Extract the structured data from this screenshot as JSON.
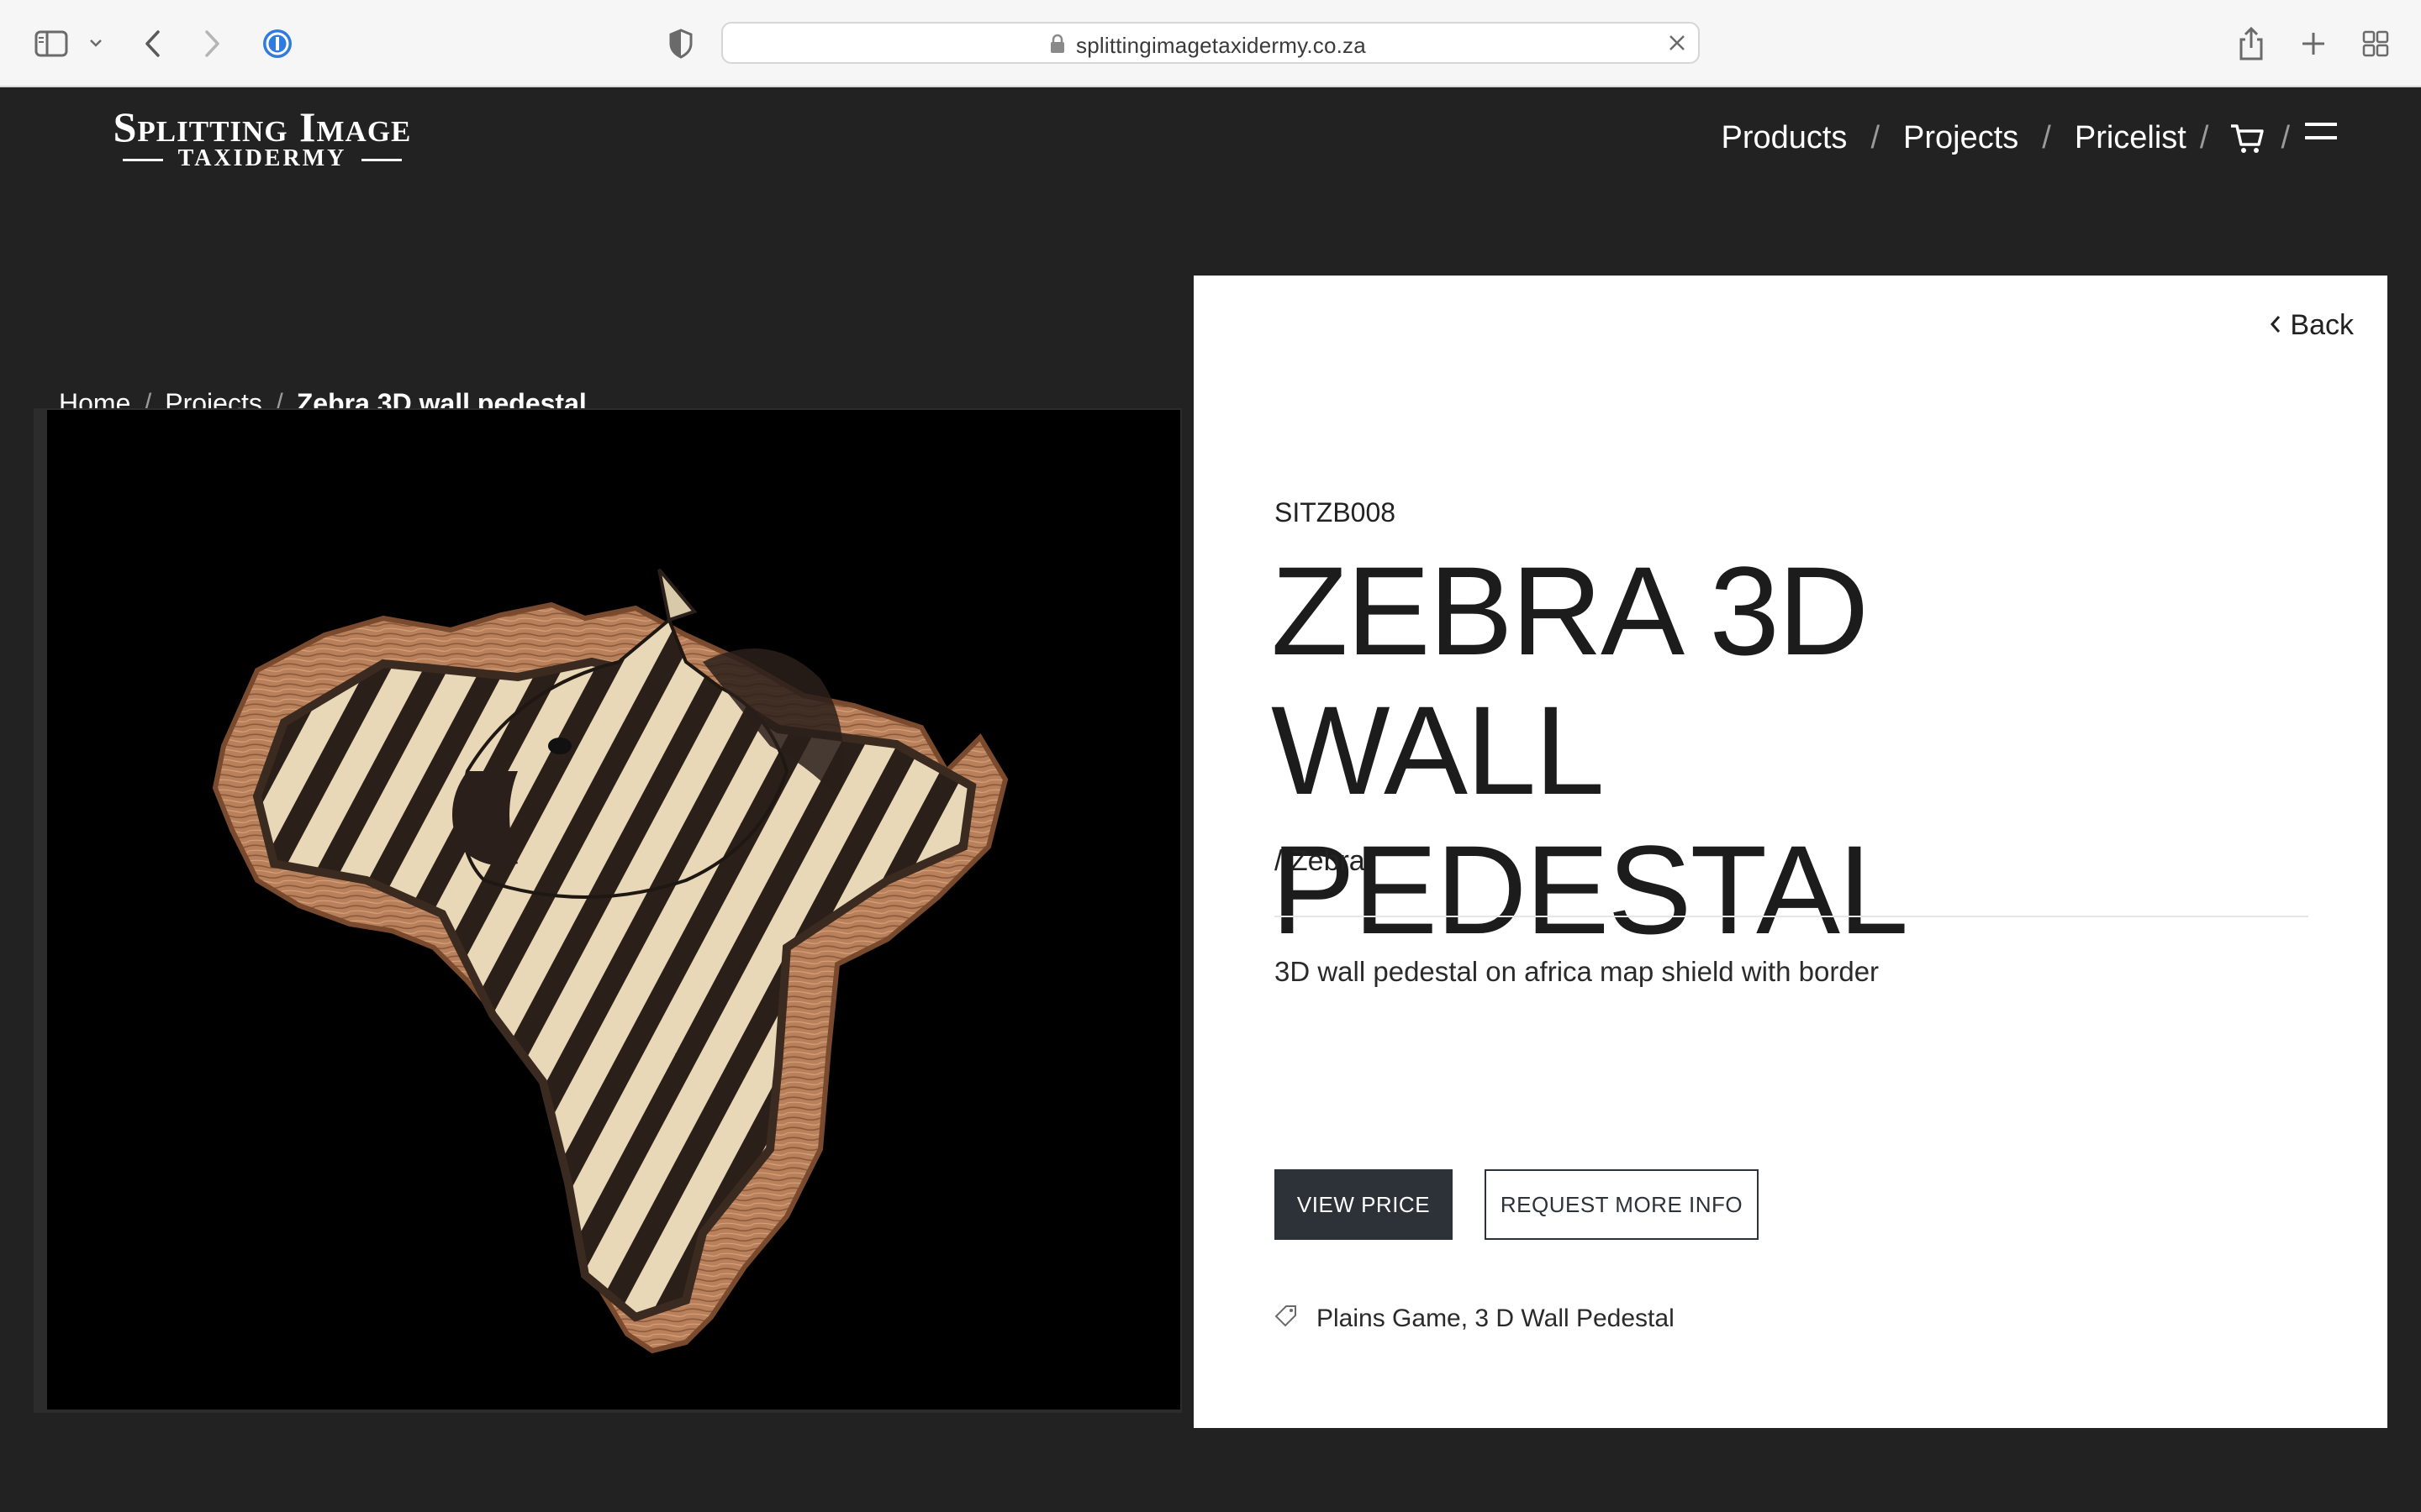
{
  "browser": {
    "url": "splittingimagetaxidermy.co.za"
  },
  "site": {
    "logo": {
      "line1": "Splitting Image",
      "line2": "TAXIDERMY"
    },
    "nav": {
      "products": "Products",
      "projects": "Projects",
      "pricelist": "Pricelist",
      "separator": "/"
    }
  },
  "breadcrumb": {
    "home": "Home",
    "projects": "Projects",
    "current": "Zebra 3D wall pedestal",
    "separator": "/"
  },
  "product": {
    "back_label": "Back",
    "sku": "SITZB008",
    "title_line1": "ZEBRA 3D WALL",
    "title_line2": "PEDESTAL",
    "category": "/ Zebra",
    "description": "3D wall pedestal on africa map shield with border",
    "view_price_label": "VIEW PRICE",
    "request_info_label": "REQUEST MORE INFO",
    "tags": "Plains Game, 3 D Wall Pedestal"
  },
  "colors": {
    "site_bg": "#222223",
    "panel_bg": "#ffffff",
    "button_dark": "#2d3138",
    "wood": "#b9805c",
    "zebra_cream": "#e6d6b8",
    "zebra_dark": "#2a1f1a"
  },
  "icons": [
    "sidebar-icon",
    "chevron-down-icon",
    "back-arrow-icon",
    "forward-arrow-icon",
    "password-manager-icon",
    "privacy-shield-icon",
    "lock-icon",
    "clear-icon",
    "share-icon",
    "new-tab-icon",
    "tab-overview-icon",
    "cart-icon",
    "menu-icon",
    "chevron-left-icon",
    "tag-icon"
  ]
}
